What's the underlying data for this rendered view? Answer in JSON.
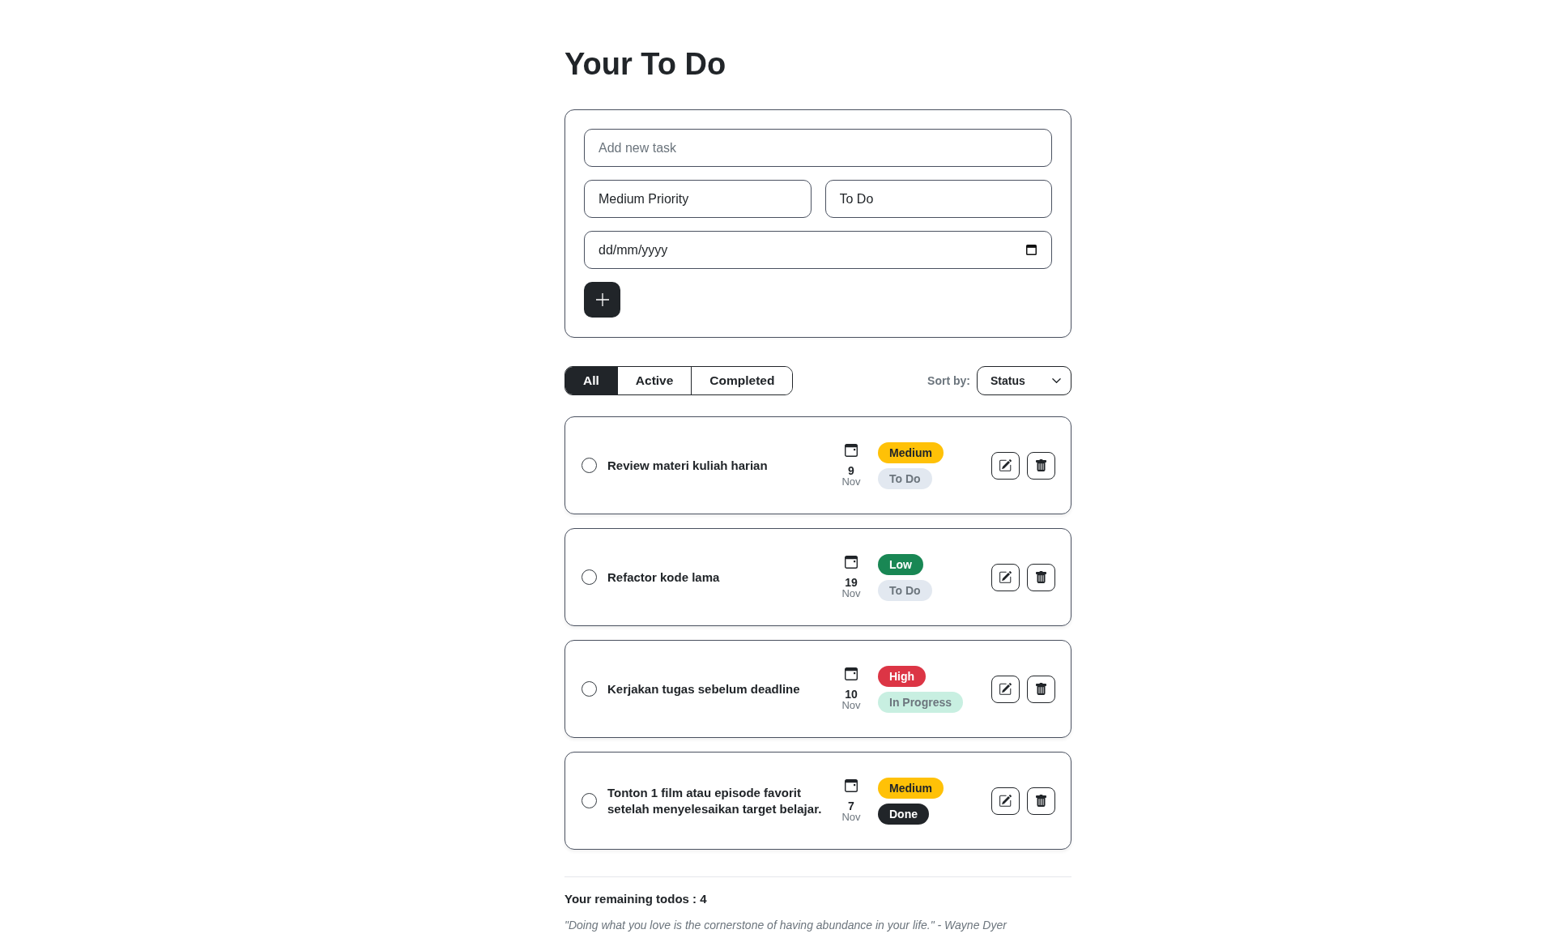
{
  "title": "Your To Do",
  "new_task_form": {
    "task_input": {
      "placeholder": "Add new task"
    },
    "priority_select": {
      "value": "Medium Priority"
    },
    "status_select": {
      "value": "To Do"
    },
    "due_date_input": {
      "placeholder": "dd/mm/yyyy"
    }
  },
  "filter_tabs": [
    {
      "label": "All",
      "selected": true
    },
    {
      "label": "Active",
      "selected": false
    },
    {
      "label": "Completed",
      "selected": false
    }
  ],
  "sort": {
    "label": "Sort by:",
    "value": "Status"
  },
  "tasks": [
    {
      "text": "Review materi kuliah harian",
      "checked": false,
      "due_day": "9",
      "due_month": "Nov",
      "priority": {
        "kind": "medium",
        "label": "Medium"
      },
      "status": {
        "kind": "todo",
        "label": "To Do"
      }
    },
    {
      "text": "Refactor kode lama",
      "checked": false,
      "due_day": "19",
      "due_month": "Nov",
      "priority": {
        "kind": "low",
        "label": "Low"
      },
      "status": {
        "kind": "todo",
        "label": "To Do"
      }
    },
    {
      "text": "Kerjakan tugas sebelum deadline",
      "checked": false,
      "due_day": "10",
      "due_month": "Nov",
      "priority": {
        "kind": "high",
        "label": "High"
      },
      "status": {
        "kind": "in_progress",
        "label": "In Progress"
      }
    },
    {
      "text": "Tonton 1 film atau episode favorit setelah menyelesaikan target belajar.",
      "checked": false,
      "due_day": "7",
      "due_month": "Nov",
      "priority": {
        "kind": "medium",
        "label": "Medium"
      },
      "status": {
        "kind": "done",
        "label": "Done"
      }
    }
  ],
  "remaining_count": "Your remaining todos : 4",
  "quote": "\"Doing what you love is the cornerstone of having abundance in your life.\" - Wayne Dyer"
}
